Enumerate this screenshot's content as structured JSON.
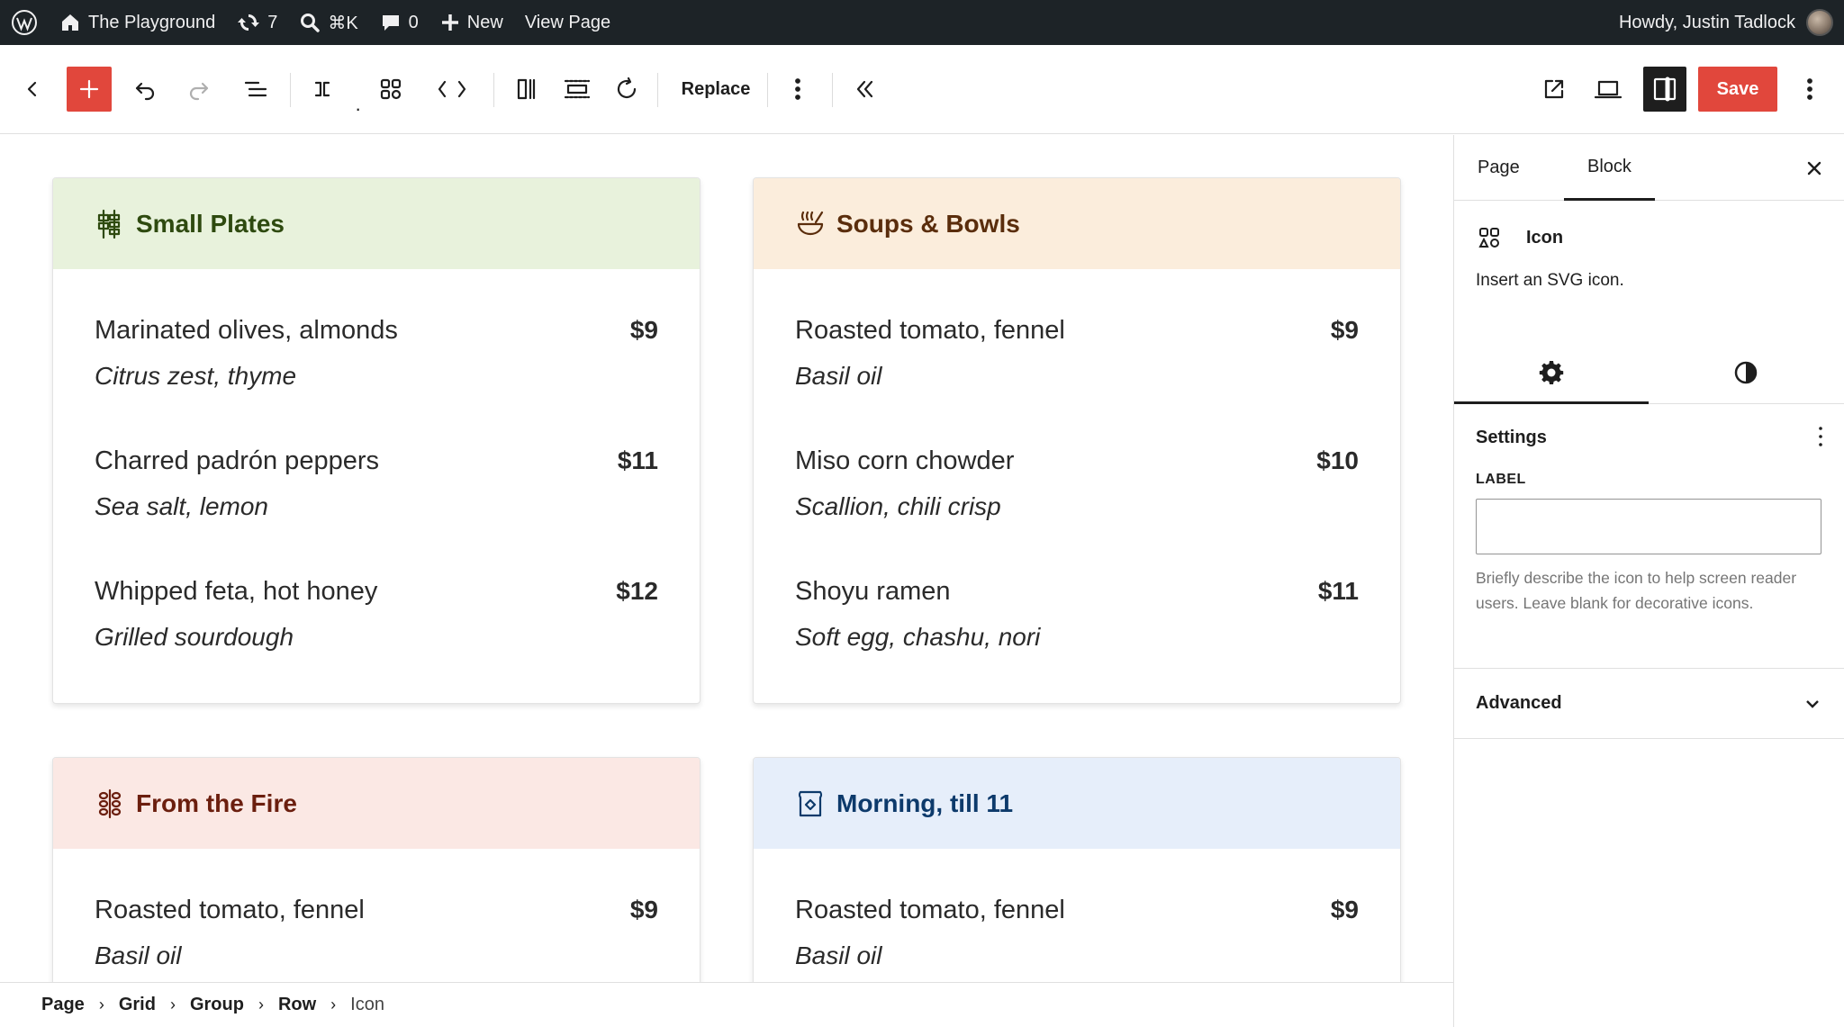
{
  "admin_bar": {
    "site_name": "The Playground",
    "updates_count": "7",
    "search_shortcut": "⌘K",
    "comments_count": "0",
    "new_label": "New",
    "view_page_label": "View Page",
    "greeting": "Howdy, Justin Tadlock"
  },
  "toolbar": {
    "replace_label": "Replace",
    "save_label": "Save"
  },
  "colors": {
    "accent": "#e1473c",
    "admin_bar_bg": "#1d2327"
  },
  "cards": [
    {
      "title": "Small Plates",
      "icon": "skewer-icon",
      "header_bg": "#e8f2dc",
      "title_color": "#2e4a0f",
      "items": [
        {
          "name": "Marinated olives, almonds",
          "desc": "Citrus zest, thyme",
          "price": "$9"
        },
        {
          "name": "Charred padrón peppers",
          "desc": "Sea salt, lemon",
          "price": "$11"
        },
        {
          "name": "Whipped feta, hot honey",
          "desc": "Grilled sourdough",
          "price": "$12"
        }
      ]
    },
    {
      "title": "Soups & Bowls",
      "icon": "soup-bowl-icon",
      "header_bg": "#fbeddc",
      "title_color": "#5a2d0c",
      "items": [
        {
          "name": "Roasted tomato, fennel",
          "desc": "Basil oil",
          "price": "$9"
        },
        {
          "name": "Miso corn chowder",
          "desc": "Scallion, chili crisp",
          "price": "$10"
        },
        {
          "name": "Shoyu ramen",
          "desc": "Soft egg, chashu, nori",
          "price": "$11"
        }
      ]
    },
    {
      "title": "From the Fire",
      "icon": "grill-icon",
      "header_bg": "#fbe8e4",
      "title_color": "#6b1e0e",
      "items": [
        {
          "name": "Roasted tomato, fennel",
          "desc": "Basil oil",
          "price": "$9"
        }
      ]
    },
    {
      "title": "Morning, till 11",
      "icon": "toast-icon",
      "header_bg": "#e6eefa",
      "title_color": "#0d3a6b",
      "items": [
        {
          "name": "Roasted tomato, fennel",
          "desc": "Basil oil",
          "price": "$9"
        }
      ]
    }
  ],
  "sidebar": {
    "tabs": [
      "Page",
      "Block"
    ],
    "block_title": "Icon",
    "block_description": "Insert an SVG icon.",
    "settings_title": "Settings",
    "label_field_label": "LABEL",
    "label_value": "",
    "help_text": "Briefly describe the icon to help screen reader users. Leave blank for decorative icons.",
    "advanced_title": "Advanced"
  },
  "breadcrumbs": [
    "Page",
    "Grid",
    "Group",
    "Row",
    "Icon"
  ]
}
